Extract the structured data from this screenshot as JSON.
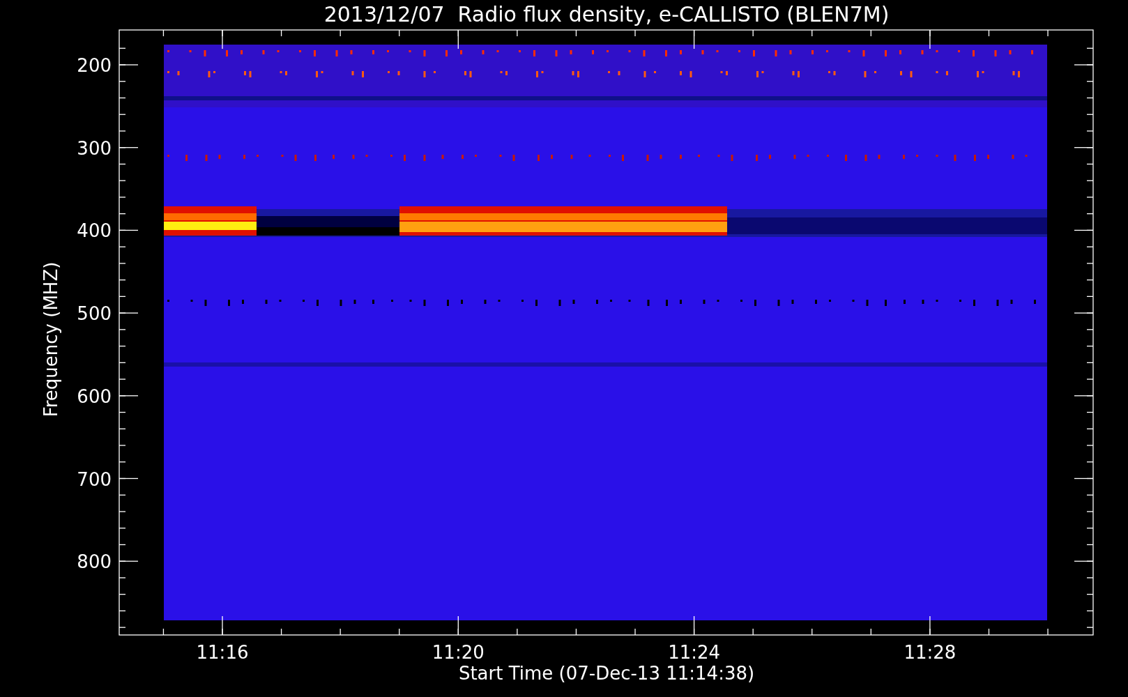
{
  "title": "2013/12/07  Radio flux density, e-CALLISTO (BLEN7M)",
  "y_axis": {
    "label": "Frequency (MHZ)",
    "ticks": [
      "200",
      "300",
      "400",
      "500",
      "600",
      "700",
      "800"
    ]
  },
  "x_axis": {
    "label": "Start Time (07-Dec-13 11:14:38)",
    "ticks": [
      "11:16",
      "11:20",
      "11:24",
      "11:28"
    ]
  }
}
